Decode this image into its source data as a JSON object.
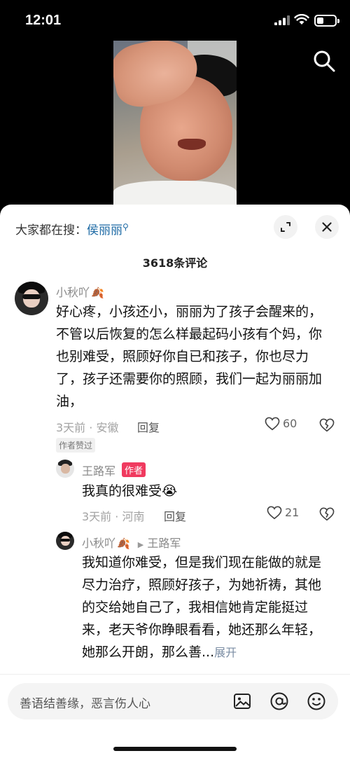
{
  "status_bar": {
    "time": "12:01"
  },
  "sheet": {
    "hot_search_label": "大家都在搜：",
    "hot_search_keyword": "侯丽丽",
    "comment_count": "3618条评论"
  },
  "comments": [
    {
      "user": "小秋吖",
      "text": "好心疼，小孩还小，丽丽为了孩子会醒来的，不管以后恢复的怎么样最起码小孩有个妈，你也别难受，照顾好你自已和孩子，你也尽力了，孩子还需要你的照顾，我们一起为丽丽加油，",
      "time_location": "3天前 · 安徽",
      "reply_label": "回复",
      "likes": "60",
      "badge": "作者赞过"
    },
    {
      "user": "王路军",
      "author_badge": "作者",
      "text": "我真的很难受😭",
      "time_location": "3天前 · 河南",
      "reply_label": "回复",
      "likes": "21"
    },
    {
      "user": "小秋吖",
      "reply_to": "王路军",
      "text": "我知道你难受，但是我们现在能做的就是尽力治疗，照顾好孩子，为她祈祷，其他的交给她自己了，我相信她肯定能挺过来，老天爷你睁眼看看，她还那么年轻，她那么开朗，那么善...",
      "expand_label": "展开"
    }
  ],
  "input": {
    "placeholder": "善语结善缘，恶言伤人心"
  },
  "icons": [
    "search-icon",
    "expand-icon",
    "close-icon",
    "heart-icon",
    "broken-heart-icon",
    "image-icon",
    "at-icon",
    "emoji-icon"
  ]
}
